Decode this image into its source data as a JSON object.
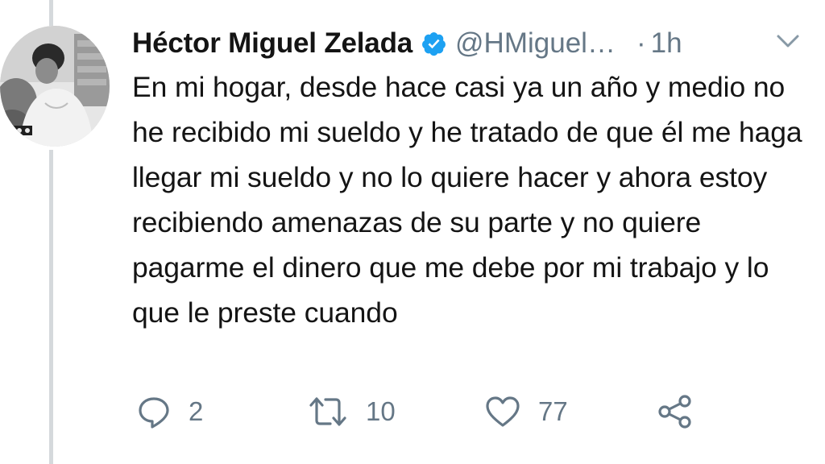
{
  "tweet": {
    "display_name": "Héctor Miguel Zelada",
    "handle": "@HMiguel…",
    "separator": "·",
    "timestamp": "1h",
    "text": "En mi hogar, desde hace casi ya un año y medio no he recibido mi sueldo y he tratado de que él me haga llegar mi sueldo y no lo quiere hacer y ahora estoy recibiendo amenazas de su parte y no quiere pagarme el dinero que me debe por mi trabajo y lo que le preste cuando",
    "verified": true,
    "actions": {
      "reply_count": "2",
      "retweet_count": "10",
      "like_count": "77"
    }
  },
  "icons": {
    "verified": "verified-badge-icon",
    "menu": "chevron-down-icon",
    "reply": "reply-icon",
    "retweet": "retweet-icon",
    "like": "heart-icon",
    "share": "share-icon"
  },
  "colors": {
    "text": "#141414",
    "secondary": "#657786",
    "verified_blue": "#1da1f2",
    "thread_line": "#d5d9dc"
  }
}
